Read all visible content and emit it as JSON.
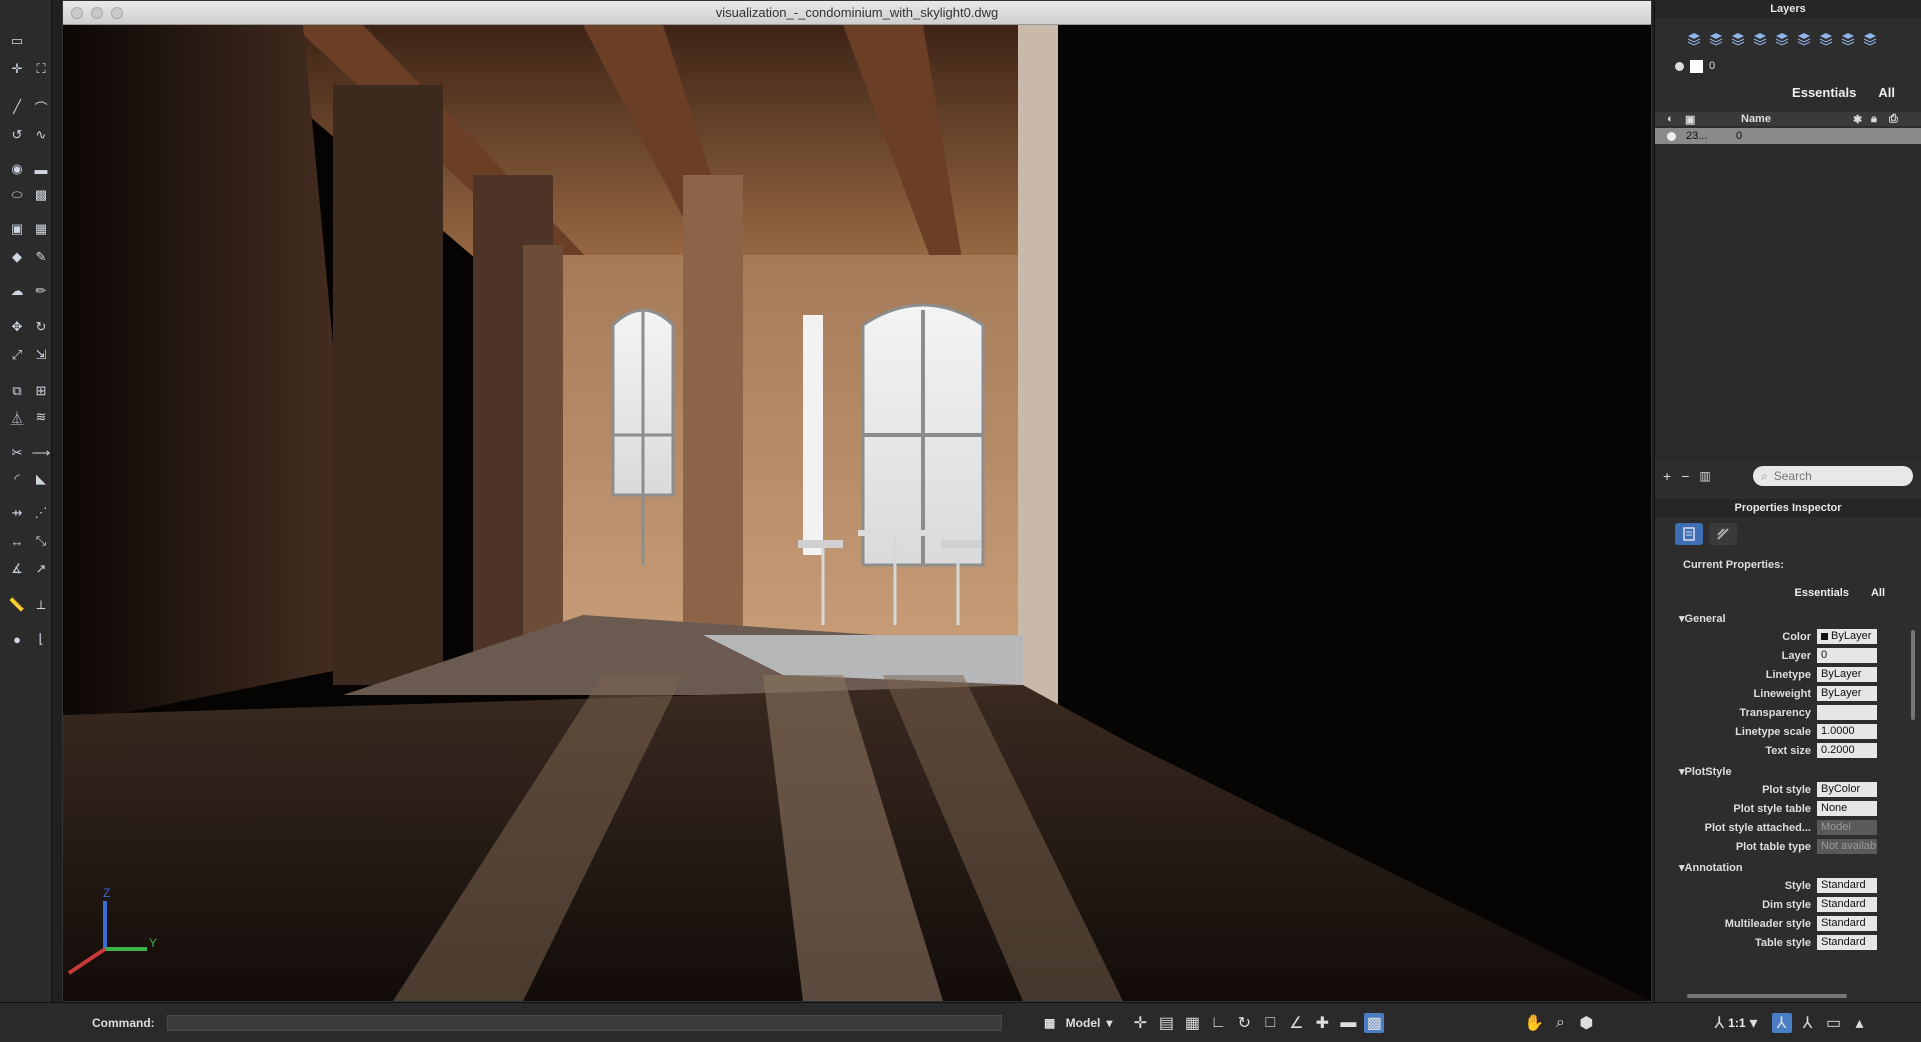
{
  "window": {
    "title": "visualization_-_condominium_with_skylight0.dwg"
  },
  "tool_palette": {
    "rows": [
      [
        "selection-icon"
      ],
      [
        "point-icon",
        "multi-select-icon"
      ],
      [
        "line-icon",
        "polyline-icon"
      ],
      [
        "arc-icon",
        "spline-icon"
      ],
      [
        "circle-icon",
        "rectangle-icon"
      ],
      [
        "ellipse-icon",
        "hatch-icon"
      ],
      [
        "block-icon",
        "table-icon"
      ],
      [
        "tag-icon",
        "attribute-icon"
      ],
      [
        "cloud-icon",
        "pencil-icon"
      ],
      [
        "move-icon",
        "rotate-icon"
      ],
      [
        "scale-icon",
        "stretch-icon"
      ],
      [
        "copy-icon",
        "array-icon"
      ],
      [
        "mirror-icon",
        "offset-icon"
      ],
      [
        "trim-icon",
        "extend-icon"
      ],
      [
        "fillet-icon",
        "chamfer-icon"
      ],
      [
        "join-icon",
        "break-icon"
      ],
      [
        "dim-linear-icon",
        "dim-aligned-icon"
      ],
      [
        "dim-angular-icon",
        "leader-icon"
      ],
      [
        "measure-icon",
        "distance-icon"
      ],
      [
        "render-icon",
        "ucs-icon"
      ]
    ]
  },
  "viewport": {
    "ucs": {
      "z": "Z",
      "y": "Y"
    }
  },
  "layers_panel": {
    "title": "Layers",
    "tool_icons": [
      "new-layer-icon",
      "new-layer-vp-icon",
      "delete-layer-icon",
      "set-current-icon",
      "isolate-icon",
      "unisolate-icon",
      "freeze-icon",
      "lock-icon",
      "match-layer-icon"
    ],
    "current_layer": "0",
    "tabs": [
      "Essentials",
      "All"
    ],
    "columns": {
      "name": "Name"
    },
    "rows": [
      {
        "count": "23...",
        "name": "0"
      }
    ],
    "search_placeholder": "Search"
  },
  "properties_inspector": {
    "title": "Properties Inspector",
    "current_label": "Current Properties:",
    "tabs": [
      "Essentials",
      "All"
    ],
    "sections": [
      {
        "title": "General",
        "props": [
          {
            "label": "Color",
            "value": "ByLayer",
            "swatch": true
          },
          {
            "label": "Layer",
            "value": "0"
          },
          {
            "label": "Linetype",
            "value": "ByLayer"
          },
          {
            "label": "Lineweight",
            "value": "ByLayer"
          },
          {
            "label": "Transparency",
            "value": ""
          },
          {
            "label": "Linetype scale",
            "value": "1.0000"
          },
          {
            "label": "Text size",
            "value": "0.2000"
          }
        ]
      },
      {
        "title": "PlotStyle",
        "props": [
          {
            "label": "Plot style",
            "value": "ByColor"
          },
          {
            "label": "Plot style table",
            "value": "None"
          },
          {
            "label": "Plot style attached...",
            "value": "Model",
            "disabled": true
          },
          {
            "label": "Plot table type",
            "value": "Not availab",
            "disabled": true
          }
        ]
      },
      {
        "title": "Annotation",
        "props": [
          {
            "label": "Style",
            "value": "Standard"
          },
          {
            "label": "Dim style",
            "value": "Standard"
          },
          {
            "label": "Multileader style",
            "value": "Standard"
          },
          {
            "label": "Table style",
            "value": "Standard"
          }
        ]
      }
    ]
  },
  "status_bar": {
    "command_label": "Command:",
    "model_label": "Model",
    "scale_label": "1:1"
  },
  "colors": {
    "accent": "#4a7ec4",
    "panel_bg": "#2d2d2d",
    "viewport_bg": "#050505"
  }
}
